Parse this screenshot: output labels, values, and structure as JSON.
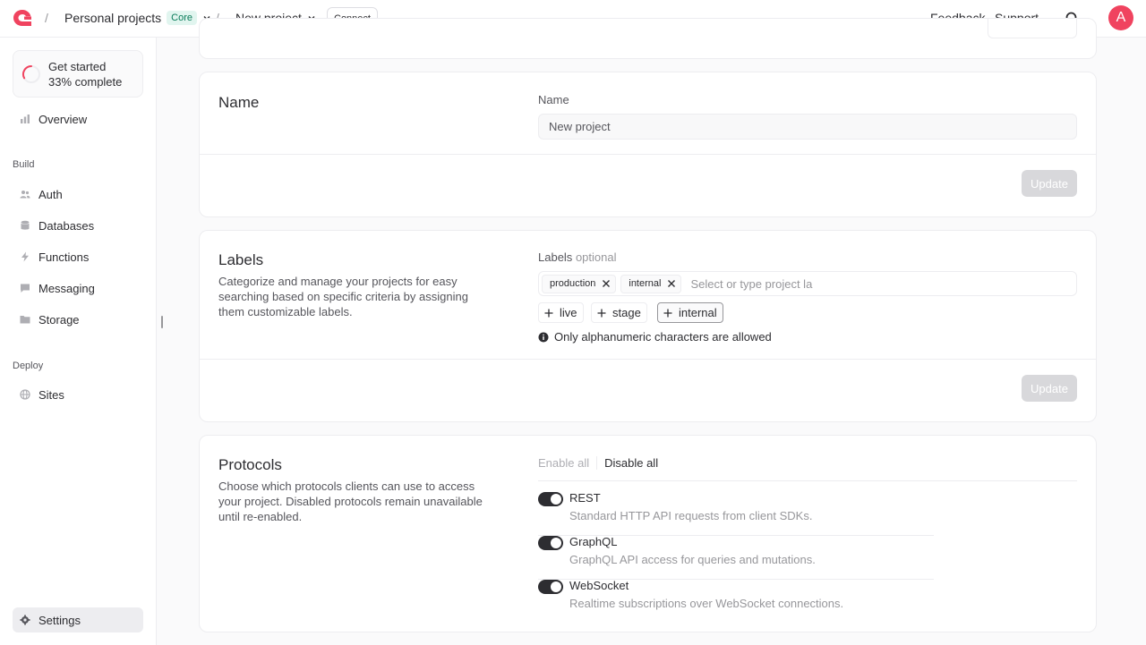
{
  "header": {
    "project_group": "Personal projects",
    "plan_badge": "Core",
    "project_name": "New project",
    "connect_label": "Connect",
    "feedback_label": "Feedback",
    "support_label": "Support",
    "avatar_initial": "A"
  },
  "sidebar": {
    "get_started_title": "Get started",
    "get_started_progress": "33% complete",
    "progress_fraction": 0.33,
    "overview": "Overview",
    "build_section": "Build",
    "build_items": [
      "Auth",
      "Databases",
      "Functions",
      "Messaging",
      "Storage"
    ],
    "deploy_section": "Deploy",
    "deploy_items": [
      "Sites"
    ],
    "settings": "Settings"
  },
  "name_card": {
    "title": "Name",
    "field_label": "Name",
    "field_value": "New project",
    "update_label": "Update"
  },
  "labels_card": {
    "title": "Labels",
    "description": "Categorize and manage your projects for easy searching based on specific criteria by assigning them customizable labels.",
    "field_label": "Labels",
    "optional_label": "optional",
    "tags": [
      "production",
      "internal"
    ],
    "placeholder": "Select or type project la",
    "suggestions": [
      "live",
      "stage",
      "internal"
    ],
    "hint": "Only alphanumeric characters are allowed",
    "update_label": "Update"
  },
  "protocols_card": {
    "title": "Protocols",
    "description": "Choose which protocols clients can use to access your project. Disabled protocols remain unavailable until re-enabled.",
    "enable_all": "Enable all",
    "disable_all": "Disable all",
    "protocols": [
      {
        "name": "REST",
        "description": "Standard HTTP API requests from client SDKs.",
        "enabled": true
      },
      {
        "name": "GraphQL",
        "description": "GraphQL API access for queries and mutations.",
        "enabled": true
      },
      {
        "name": "WebSocket",
        "description": "Realtime subscriptions over WebSocket connections.",
        "enabled": true
      }
    ]
  },
  "colors": {
    "accent": "#f0435f",
    "badge_bg": "#e1f5ef",
    "badge_text": "#0a7c5a",
    "toggle_on": "#2d2d31"
  }
}
